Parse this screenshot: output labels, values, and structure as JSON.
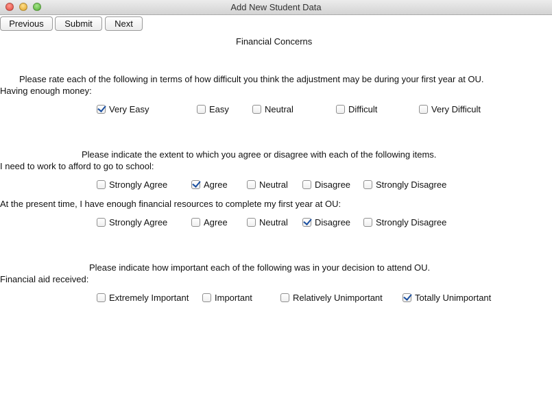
{
  "window": {
    "title": "Add New Student Data"
  },
  "toolbar": {
    "previous_label": "Previous",
    "submit_label": "Submit",
    "next_label": "Next"
  },
  "section_title": "Financial Concerns",
  "q1": {
    "instruction": "Please rate each of the following in terms of how difficult you think the adjustment may be during your first year at OU.",
    "item": "Having enough money:",
    "options": [
      {
        "label": "Very Easy",
        "checked": true
      },
      {
        "label": "Easy",
        "checked": false
      },
      {
        "label": "Neutral",
        "checked": false
      },
      {
        "label": "Difficult",
        "checked": false
      },
      {
        "label": "Very Difficult",
        "checked": false
      }
    ]
  },
  "q2": {
    "instruction": "Please indicate the extent to which you agree or disagree with each of the following items.",
    "item1": "I need to work to afford to go to school:",
    "item1_options": [
      {
        "label": "Strongly Agree",
        "checked": false
      },
      {
        "label": "Agree",
        "checked": true
      },
      {
        "label": "Neutral",
        "checked": false
      },
      {
        "label": "Disagree",
        "checked": false
      },
      {
        "label": "Strongly Disagree",
        "checked": false
      }
    ],
    "item2": "At the present time, I have enough financial resources to complete my first year at OU:",
    "item2_options": [
      {
        "label": "Strongly Agree",
        "checked": false
      },
      {
        "label": "Agree",
        "checked": false
      },
      {
        "label": "Neutral",
        "checked": false
      },
      {
        "label": "Disagree",
        "checked": true
      },
      {
        "label": "Strongly Disagree",
        "checked": false
      }
    ]
  },
  "q3": {
    "instruction": "Please indicate how important each of the following was in your decision to attend OU.",
    "item": "Financial aid received:",
    "options": [
      {
        "label": "Extremely Important",
        "checked": false
      },
      {
        "label": "Important",
        "checked": false
      },
      {
        "label": "Relatively Unimportant",
        "checked": false
      },
      {
        "label": "Totally Unimportant",
        "checked": true
      }
    ]
  }
}
